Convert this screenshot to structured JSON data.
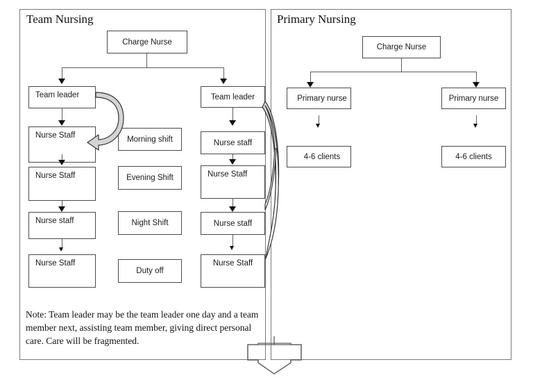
{
  "panels": [
    {
      "id": "team-nursing",
      "title": "Team Nursing",
      "charge_nurse": "Charge Nurse",
      "left_column": [
        "Team leader",
        "Nurse Staff",
        "Nurse Staff",
        "Nurse staff",
        "Nurse Staff"
      ],
      "shift_column": [
        "Morning shift",
        "Evening Shift",
        "Night Shift",
        "Duty off"
      ],
      "right_column": [
        "Team leader",
        "Nurse staff",
        "Nurse Staff",
        "Nurse staff",
        "Nurse Staff"
      ],
      "note": "Note: Team leader may be the team leader one day and a team member next, assisting team member, giving direct personal care. Care will be fragmented."
    },
    {
      "id": "primary-nursing",
      "title": "Primary Nursing",
      "charge_nurse": "Charge Nurse",
      "left_branch": {
        "nurse": "Primary nurse",
        "clients": "4-6 clients"
      },
      "right_branch": {
        "nurse": "Primary nurse",
        "clients": "4-6 clients"
      }
    }
  ],
  "colors": {
    "panel_border": "#7a7a7a",
    "box_border": "#4a4a4a",
    "connector": "#5e5e5e",
    "arrow_fill": "#111111",
    "curve_fill": "#d4d4d4",
    "text": "#1a1a1a",
    "background": "#ffffff"
  },
  "icons": {
    "down_arrow": "down-arrow-icon",
    "loop_arrow": "curved-loop-arrow-icon",
    "block_arrow": "block-down-arrow-icon"
  }
}
